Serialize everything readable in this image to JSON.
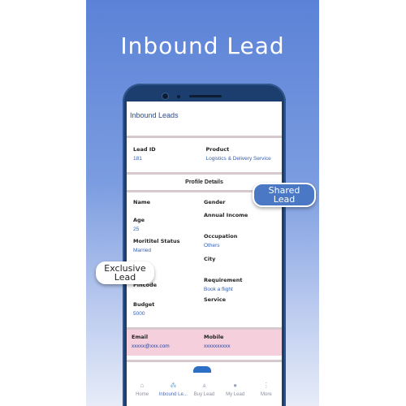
{
  "banner": {
    "title": "Inbound Lead"
  },
  "app": {
    "header_title": "Inbound Leads",
    "lead": {
      "id_label": "Lead ID",
      "id_value": "181",
      "product_label": "Product",
      "product_value": "Logistics & Delivery Service"
    },
    "profile": {
      "section_title": "Profile Details",
      "name_label": "Name",
      "gender_label": "Gender",
      "age_label": "Age",
      "age_value": "25",
      "income_label": "Annual Income",
      "marital_label": "Morititel Status",
      "marital_value": "Married",
      "occupation_label": "Occupation",
      "occupation_value": "Others",
      "city_label": "City",
      "pincode_label": "Pincode",
      "requirement_label": "Requirement",
      "requirement_value": "Book a flight",
      "budget_label": "Budget",
      "budget_value": "5000",
      "service_label": "Service"
    },
    "contact": {
      "email_label": "Email",
      "email_value": "xxxxx@xxx.com",
      "mobile_label": "Mobile",
      "mobile_value": "xxxxxxxxxx"
    },
    "tabs": [
      {
        "label": "Home",
        "icon": "home-icon"
      },
      {
        "label": "Inbound Le...",
        "icon": "inbound-icon"
      },
      {
        "label": "Buy Lead",
        "icon": "buy-icon"
      },
      {
        "label": "My Lead",
        "icon": "person-icon"
      },
      {
        "label": "More",
        "icon": "more-icon"
      }
    ]
  },
  "callouts": {
    "shared_line1": "Shared",
    "shared_line2": "Lead",
    "exclusive_line1": "Exclusive",
    "exclusive_line2": "Lead"
  },
  "colors": {
    "banner_top": "#5b82d7",
    "phone_frame": "#1c3e6e",
    "accent_blue": "#3560b5",
    "contact_bg": "#f5d0dc"
  }
}
